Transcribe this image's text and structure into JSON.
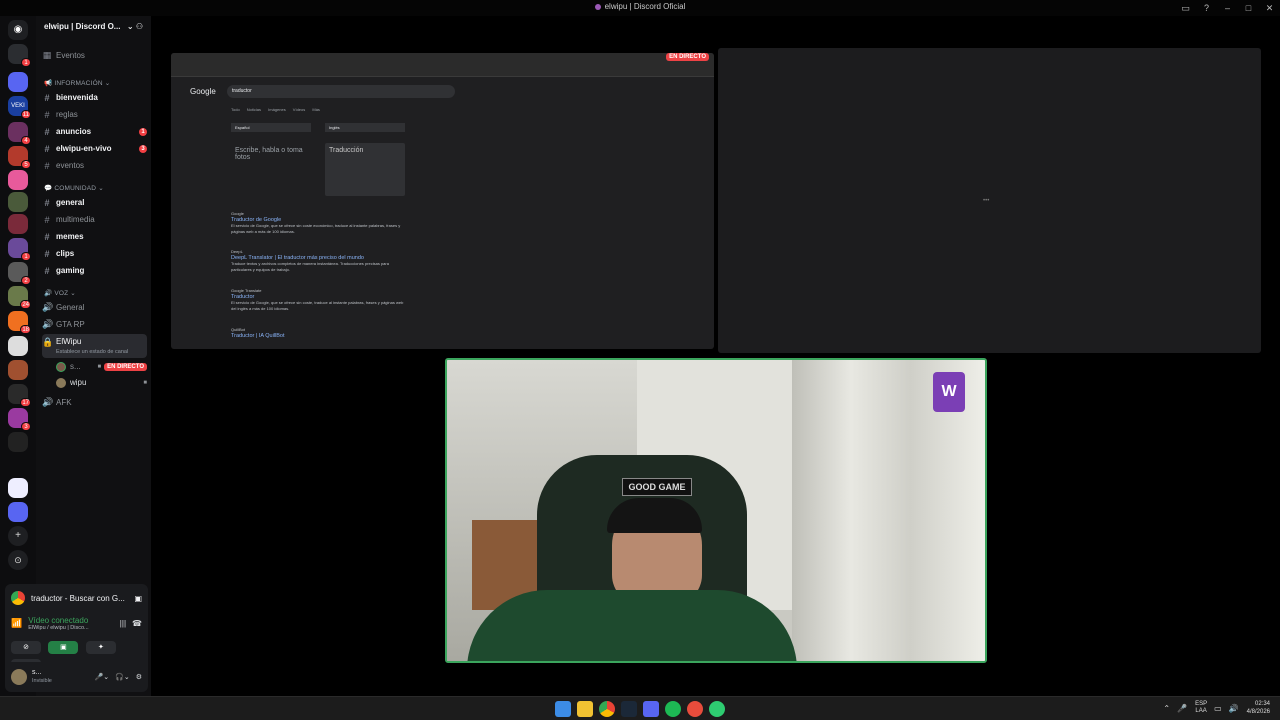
{
  "window": {
    "title": "elwipu | Discord Oficial"
  },
  "guild": {
    "name": "elwipu | Discord O..."
  },
  "events_label": "Eventos",
  "categories": {
    "info": "INFORMACIÓN",
    "community": "COMUNIDAD",
    "voice": "VOZ"
  },
  "channels": [
    {
      "name": "bienvenida",
      "bold": true,
      "badge": ""
    },
    {
      "name": "reglas",
      "bold": false,
      "badge": ""
    },
    {
      "name": "anuncios",
      "bold": true,
      "badge": "1"
    },
    {
      "name": "elwipu-en-vivo",
      "bold": true,
      "badge": "3"
    },
    {
      "name": "eventos",
      "bold": false,
      "badge": ""
    },
    {
      "name": "general",
      "bold": true,
      "badge": ""
    },
    {
      "name": "multimedia",
      "bold": false,
      "badge": ""
    },
    {
      "name": "memes",
      "bold": true,
      "badge": ""
    },
    {
      "name": "clips",
      "bold": true,
      "badge": ""
    },
    {
      "name": "gaming",
      "bold": true,
      "badge": ""
    }
  ],
  "voice_channels": {
    "general": "General",
    "gta": "GTA RP",
    "elwipu": "ElWipu",
    "elwipu_status": "Establece un estado de canal",
    "member1": "s...",
    "member1_live": "EN DIRECTO",
    "member2": "wipu",
    "afk": "AFK"
  },
  "stream_panel": {
    "title": "traductor - Buscar con G...",
    "connected": "Vídeo conectado",
    "location": "ElWipu / elwipu | Disco..."
  },
  "user_panel": {
    "name": "s...",
    "status": "Invisible"
  },
  "screen_share": {
    "live_badge": "EN DIRECTO",
    "search_query": "traductor",
    "google": "Google",
    "tabs": "Todo Noticias Imágenes Vídeos Más",
    "source_lang": "Español",
    "target_lang": "Inglés",
    "placeholder": "Escribe, habla o toma fotos",
    "translation_label": "Traducción",
    "results": [
      {
        "site": "Google",
        "title": "Traductor de Google",
        "snippet": "El servicio de Google, que se ofrece sin coste económico, traduce al instante palabras, frases y páginas web a más de 100 idiomas."
      },
      {
        "site": "DeepL",
        "title": "DeepL Translator | El traductor más preciso del mundo",
        "snippet": "Traduce textos y archivos completos de manera instantánea. Traducciones precisas para particulares y equipos de trabajo."
      },
      {
        "site": "Google Translate",
        "title": "Traductor",
        "snippet": "El servicio de Google, que se ofrece sin coste, traduce al instante palabras, frases y páginas web del inglés a más de 100 idiomas."
      },
      {
        "site": "QuillBot",
        "title": "Traductor | IA QuillBot",
        "snippet": ""
      }
    ]
  },
  "camera": {
    "cap_text": "GOOD GAME"
  },
  "taskbar": {
    "lang_top": "ESP",
    "lang_bottom": "LAA",
    "time": "02:34",
    "date": "4/8/2026"
  },
  "colors": {
    "live": "#ed4245",
    "speaking": "#3ba55d",
    "badge": "#f23f43"
  }
}
